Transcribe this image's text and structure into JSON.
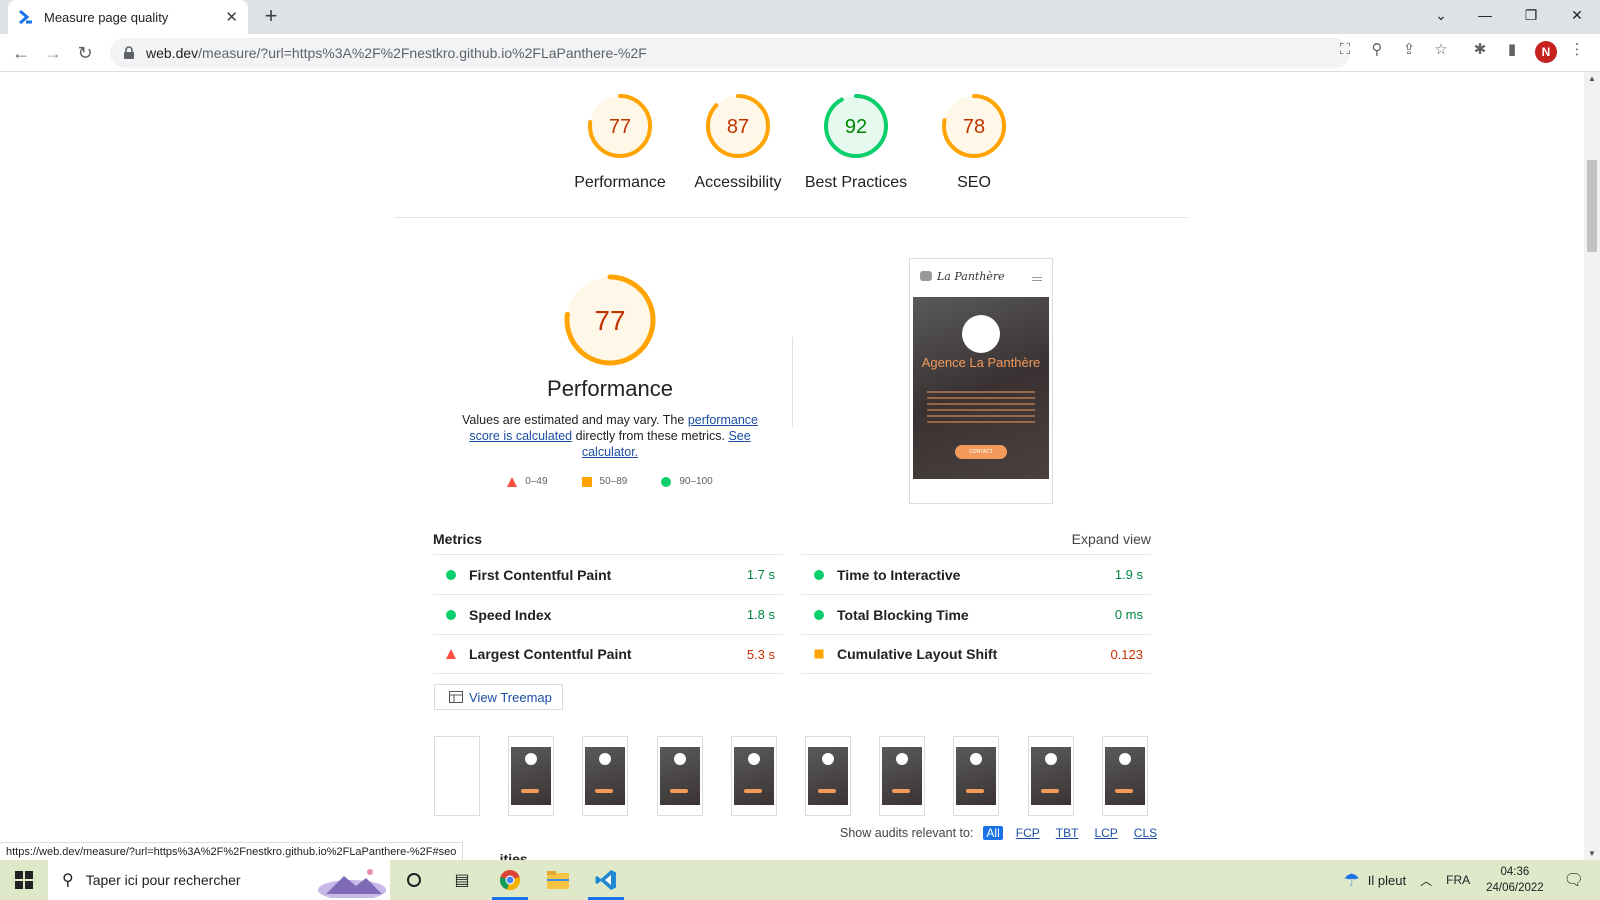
{
  "browser": {
    "tab_title": "Measure page quality",
    "url_host": "web.dev",
    "url_rest": "/measure/?url=https%3A%2F%2Fnestkro.github.io%2FLaPanthere-%2F",
    "avatar_initial": "N"
  },
  "categories": [
    {
      "score": "77",
      "label": "Performance",
      "color": "#ffa400",
      "fraction": 0.77
    },
    {
      "score": "87",
      "label": "Accessibility",
      "color": "#ffa400",
      "fraction": 0.87
    },
    {
      "score": "92",
      "label": "Best Practices",
      "color": "#0cce6b",
      "fraction": 0.92
    },
    {
      "score": "78",
      "label": "SEO",
      "color": "#ffa400",
      "fraction": 0.78
    }
  ],
  "performance": {
    "score": "77",
    "fraction": 0.77,
    "title": "Performance",
    "desc_prefix": "Values are estimated and may vary. The ",
    "desc_link1": "performance score is calculated",
    "desc_mid": " directly from these metrics. ",
    "desc_link2": "See calculator.",
    "legend": [
      {
        "range": "0–49",
        "shape": "triangle",
        "color": "#ff4e42"
      },
      {
        "range": "50–89",
        "shape": "square",
        "color": "#ffa400"
      },
      {
        "range": "90–100",
        "shape": "circle",
        "color": "#0cce6b"
      }
    ]
  },
  "screenshot": {
    "brand": "La Panthère",
    "hero_title": "Agence La Panthère",
    "button": "CONTACT"
  },
  "metrics": {
    "title": "Metrics",
    "expand_label": "Expand view",
    "left": [
      {
        "name": "First Contentful Paint",
        "value": "1.7 s",
        "status": "pass"
      },
      {
        "name": "Speed Index",
        "value": "1.8 s",
        "status": "pass"
      },
      {
        "name": "Largest Contentful Paint",
        "value": "5.3 s",
        "status": "fail"
      }
    ],
    "right": [
      {
        "name": "Time to Interactive",
        "value": "1.9 s",
        "status": "pass"
      },
      {
        "name": "Total Blocking Time",
        "value": "0 ms",
        "status": "pass"
      },
      {
        "name": "Cumulative Layout Shift",
        "value": "0.123",
        "status": "average"
      }
    ]
  },
  "treemap_label": "View Treemap",
  "audits_filter": {
    "label": "Show audits relevant to:",
    "options": [
      "All",
      "FCP",
      "TBT",
      "LCP",
      "CLS"
    ],
    "active": "All"
  },
  "partial_heading": "...ities",
  "status_url": "https://web.dev/measure/?url=https%3A%2F%2Fnestkro.github.io%2FLaPanthere-%2F#seo",
  "taskbar": {
    "search_placeholder": "Taper ici pour rechercher",
    "weather": "Il pleut",
    "lang": "FRA",
    "time": "04:36",
    "date": "24/06/2022"
  }
}
